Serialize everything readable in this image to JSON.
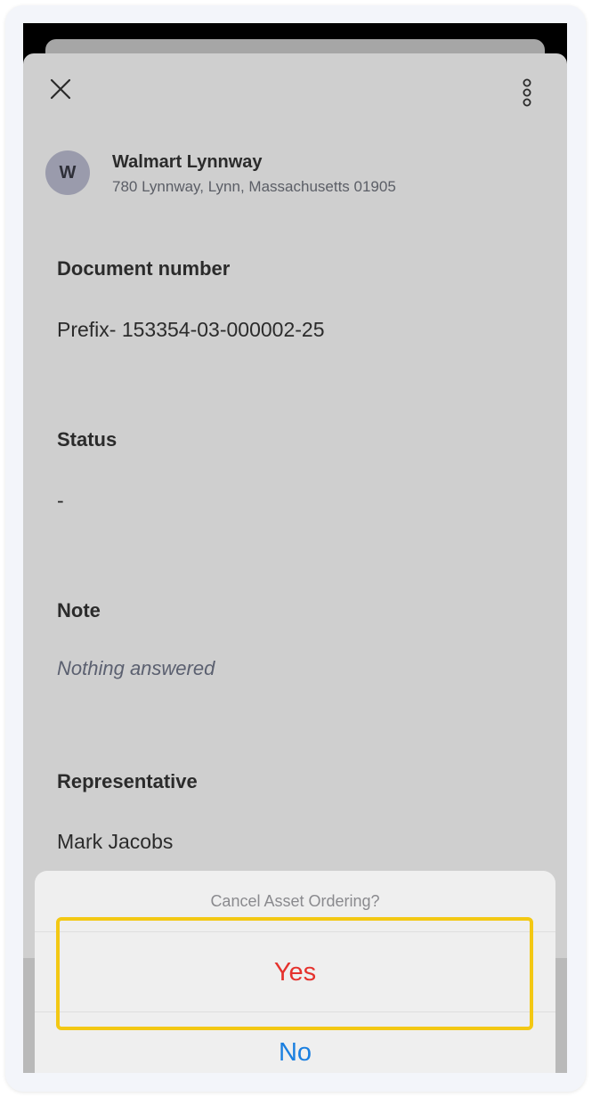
{
  "header": {
    "close_icon": "close-icon",
    "more_icon": "more-vertical-icon"
  },
  "store": {
    "avatar_initial": "W",
    "name": "Walmart Lynnway",
    "address": "780 Lynnway, Lynn, Massachusetts 01905"
  },
  "fields": {
    "document_number": {
      "label": "Document number",
      "value": "Prefix- 153354-03-000002-25"
    },
    "status": {
      "label": "Status",
      "value": "-"
    },
    "note": {
      "label": "Note",
      "value": "Nothing answered"
    },
    "representative": {
      "label": "Representative",
      "value": "Mark Jacobs"
    }
  },
  "action_sheet": {
    "title": "Cancel Asset Ordering?",
    "yes_label": "Yes",
    "no_label": "No"
  },
  "colors": {
    "destructive": "#e5322d",
    "default_action": "#1a7fe0",
    "highlight": "#f3c813",
    "avatar_bg": "#9a9bac"
  }
}
